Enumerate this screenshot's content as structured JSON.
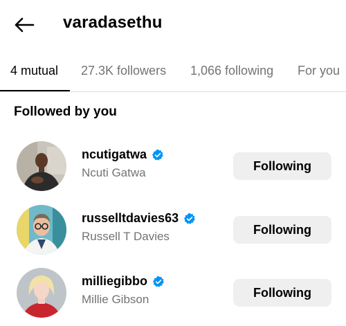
{
  "header": {
    "title": "varadasethu"
  },
  "tabs": [
    {
      "label": "4 mutual",
      "active": true
    },
    {
      "label": "27.3K followers",
      "active": false
    },
    {
      "label": "1,066 following",
      "active": false
    },
    {
      "label": "For you",
      "active": false
    }
  ],
  "section": {
    "title": "Followed by you"
  },
  "users": [
    {
      "username": "ncutigatwa",
      "name": "Ncuti Gatwa",
      "verified": true,
      "button": "Following"
    },
    {
      "username": "russelltdavies63",
      "name": "Russell T Davies",
      "verified": true,
      "button": "Following"
    },
    {
      "username": "milliegibbo",
      "name": "Millie Gibson",
      "verified": true,
      "button": "Following"
    }
  ],
  "colors": {
    "verified": "#0095f6",
    "muted": "#737373",
    "button_bg": "#efefef"
  },
  "icons": {
    "back": "arrow-left-icon",
    "verified": "verified-badge-icon"
  }
}
